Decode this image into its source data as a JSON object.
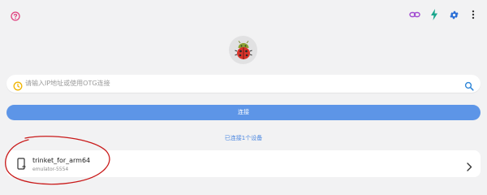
{
  "search": {
    "placeholder": "请输入IP地址或使用OTG连接"
  },
  "connect_button": {
    "label": "连接"
  },
  "status": {
    "connected_text": "已连接1个设备"
  },
  "device": {
    "name": "trinket_for_arm64",
    "serial": "emulator-5554"
  },
  "colors": {
    "accent": "#5d95e7",
    "link": "#4a86e0",
    "help": "#e0407e",
    "link_icon": "#a24bd1",
    "flash_icon": "#1aa68c",
    "gear_icon": "#2b6fd6"
  }
}
